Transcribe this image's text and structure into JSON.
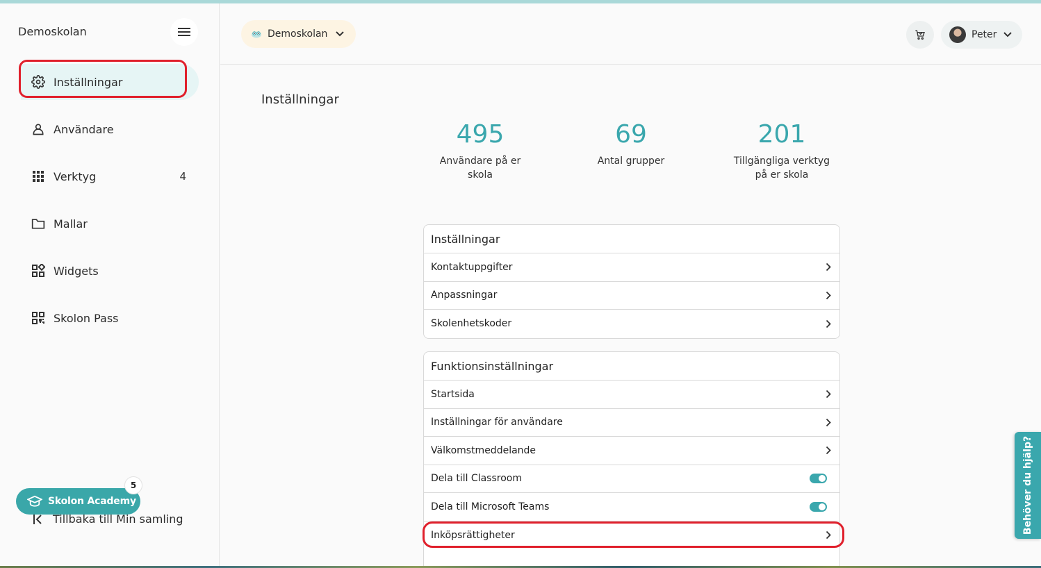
{
  "sidebar": {
    "brand": "Demoskolan",
    "items": [
      {
        "label": "Inställningar",
        "icon": "gear-icon",
        "active": true
      },
      {
        "label": "Användare",
        "icon": "user-icon"
      },
      {
        "label": "Verktyg",
        "icon": "grid-icon",
        "badge": "4"
      },
      {
        "label": "Mallar",
        "icon": "folder-icon"
      },
      {
        "label": "Widgets",
        "icon": "widgets-icon"
      },
      {
        "label": "Skolon Pass",
        "icon": "qr-code-icon"
      }
    ],
    "academy": {
      "label": "Skolon Academy",
      "badge": "5"
    },
    "back_label": "Tillbaka till Min samling"
  },
  "header": {
    "school_select": "Demoskolan",
    "user_name": "Peter"
  },
  "main": {
    "title": "Inställningar",
    "stats": [
      {
        "value": "495",
        "label": "Användare på er skola"
      },
      {
        "value": "69",
        "label": "Antal grupper"
      },
      {
        "value": "201",
        "label": "Tillgängliga verktyg på er skola"
      }
    ],
    "settings_card": {
      "title": "Inställningar",
      "rows": [
        "Kontaktuppgifter",
        "Anpassningar",
        "Skolenhetskoder"
      ]
    },
    "function_card": {
      "title": "Funktionsinställningar",
      "rows": [
        {
          "label": "Startsida",
          "type": "link"
        },
        {
          "label": "Inställningar för användare",
          "type": "link"
        },
        {
          "label": "Välkomstmeddelande",
          "type": "link"
        },
        {
          "label": "Dela till Classroom",
          "type": "toggle",
          "on": true
        },
        {
          "label": "Dela till Microsoft Teams",
          "type": "toggle",
          "on": true
        },
        {
          "label": "Inköpsrättigheter",
          "type": "link"
        }
      ]
    }
  },
  "help_tab": "Behöver du hjälp?",
  "colors": {
    "accent": "#3aa7ad",
    "annotation": "#e0202c",
    "school_pill": "#fdf4e3"
  }
}
